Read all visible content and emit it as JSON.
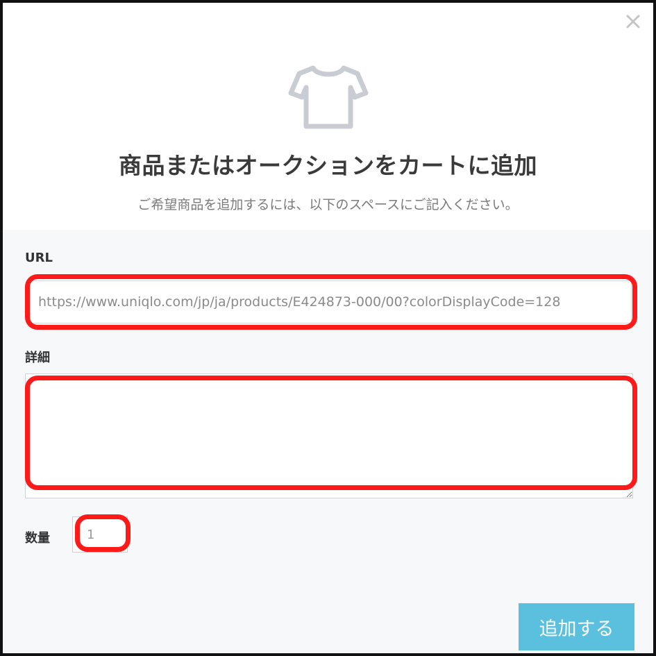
{
  "modal": {
    "title": "商品またはオークションをカートに追加",
    "subtitle": "ご希望商品を追加するには、以下のスペースにご記入ください。"
  },
  "icons": {
    "close": "close-icon",
    "product": "t-shirt-icon"
  },
  "form": {
    "url_label": "URL",
    "url_value": "https://www.uniqlo.com/jp/ja/products/E424873-000/00?colorDisplayCode=128",
    "detail_label": "詳細",
    "detail_value": "",
    "quantity_label": "数量",
    "quantity_value": "1"
  },
  "submit_label": "追加する",
  "colors": {
    "highlight": "#ff1a1a",
    "submit_button": "#5bc0de",
    "body_background": "#f7f8fa",
    "icon_gray": "#c9cdd3"
  }
}
